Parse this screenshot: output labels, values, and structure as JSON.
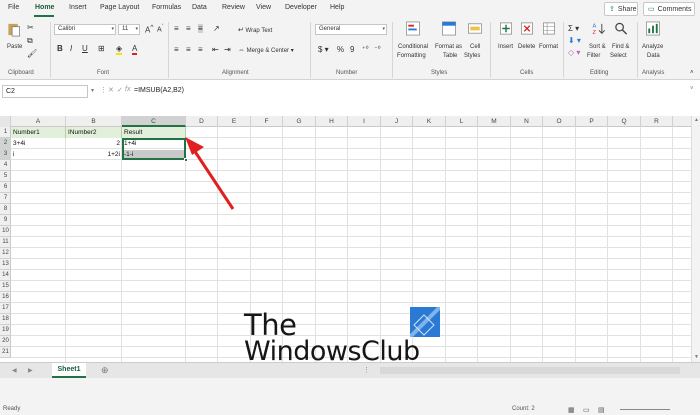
{
  "ribbon_tabs": [
    "File",
    "Home",
    "Insert",
    "Page Layout",
    "Formulas",
    "Data",
    "Review",
    "View",
    "Developer",
    "Help"
  ],
  "top_buttons": {
    "share": "Share",
    "comments": "Comments"
  },
  "clipboard": {
    "paste": "Paste",
    "label": "Clipboard"
  },
  "font": {
    "name": "Calibri",
    "size": "11",
    "label": "Font"
  },
  "alignment": {
    "wrap_text": "Wrap Text",
    "merge_center": "Merge & Center",
    "label": "Alignment"
  },
  "number": {
    "format": "General",
    "label": "Number"
  },
  "styles": {
    "conditional": [
      "Conditional",
      "Formatting"
    ],
    "format_table": [
      "Format as",
      "Table"
    ],
    "cell_styles": [
      "Cell",
      "Styles"
    ],
    "label": "Styles"
  },
  "cells": {
    "insert": "Insert",
    "delete": "Delete",
    "format": "Format",
    "label": "Cells"
  },
  "editing": {
    "sort": [
      "Sort &",
      "Filter"
    ],
    "find": [
      "Find &",
      "Select"
    ],
    "label": "Editing"
  },
  "analysis": {
    "analyze": [
      "Analyze",
      "Data"
    ],
    "label": "Analysis"
  },
  "formula_bar": {
    "name_box": "C2",
    "formula": "=IMSUB(A2,B2)"
  },
  "columns": [
    "A",
    "B",
    "C",
    "D",
    "E",
    "F",
    "G",
    "H",
    "I",
    "J",
    "K",
    "L",
    "M",
    "N",
    "O",
    "P",
    "Q",
    "R"
  ],
  "rows": [
    "1",
    "2",
    "3",
    "4",
    "5",
    "6",
    "7",
    "8",
    "9",
    "10",
    "11",
    "12",
    "13",
    "14",
    "15",
    "16",
    "17",
    "18",
    "19",
    "20",
    "21"
  ],
  "cells_data": {
    "A1": "Number1",
    "B1": "INumber2",
    "C1": "Result",
    "A2": "3+4i",
    "B2": "2",
    "C2": "1+4i",
    "A3": "i",
    "B3": "1+2i",
    "C3": "-1-i"
  },
  "sheet_tab": "Sheet1",
  "status": {
    "ready": "Ready",
    "count": "Count: 2"
  },
  "watermark": {
    "line1": "The",
    "line2": "WindowsClub"
  },
  "colors": {
    "accent": "#217346",
    "arrow": "#e02020",
    "header_fill": "#e2efda",
    "logo": "#2a79d4"
  }
}
